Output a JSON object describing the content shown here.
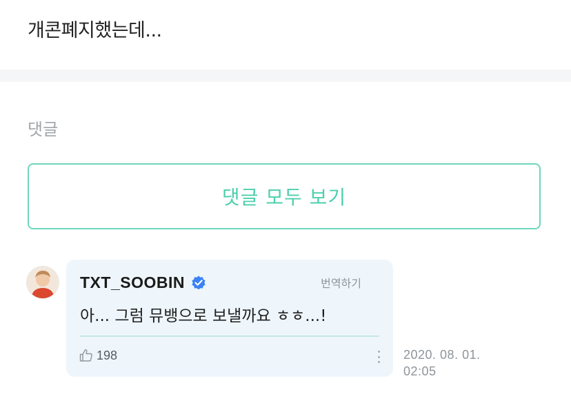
{
  "post": {
    "text": "개콘폐지했는데..."
  },
  "comments_section": {
    "label": "댓글",
    "view_all_label": "댓글 모두 보기"
  },
  "comment": {
    "author": "TXT_SOOBIN",
    "verified": true,
    "translate_label": "번역하기",
    "text": "아... 그럼 뮤뱅으로 보낼까요 ㅎㅎ...!",
    "likes": "198",
    "date": "2020. 08. 01.",
    "time": "02:05"
  },
  "colors": {
    "accent": "#4ccfac",
    "accent_border": "#6ed6bd",
    "bubble_bg": "#eef6fc",
    "verified": "#3b82f6"
  },
  "icons": {
    "verified": "verified-badge-icon",
    "like": "thumbs-up-icon",
    "more": "more-vertical-icon"
  }
}
